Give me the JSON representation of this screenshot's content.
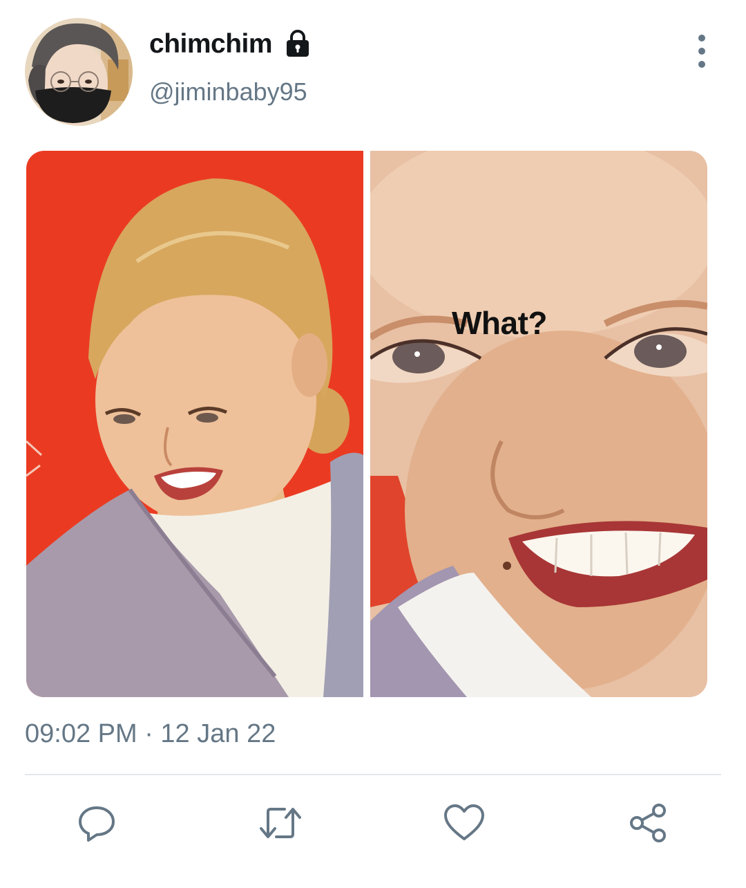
{
  "tweet": {
    "display_name": "chimchim",
    "handle": "@jiminbaby95",
    "timestamp": "09:02 PM · 12 Jan 22",
    "media": {
      "caption": "What?"
    }
  },
  "icons": {
    "lock": "lock-icon",
    "more": "more-options-icon",
    "reply": "reply-icon",
    "retweet": "retweet-icon",
    "like": "heart-icon",
    "share": "share-icon"
  },
  "colors": {
    "text_primary": "#14171a",
    "text_secondary": "#657786",
    "divider": "#e1e8ed",
    "icon": "#657786"
  }
}
